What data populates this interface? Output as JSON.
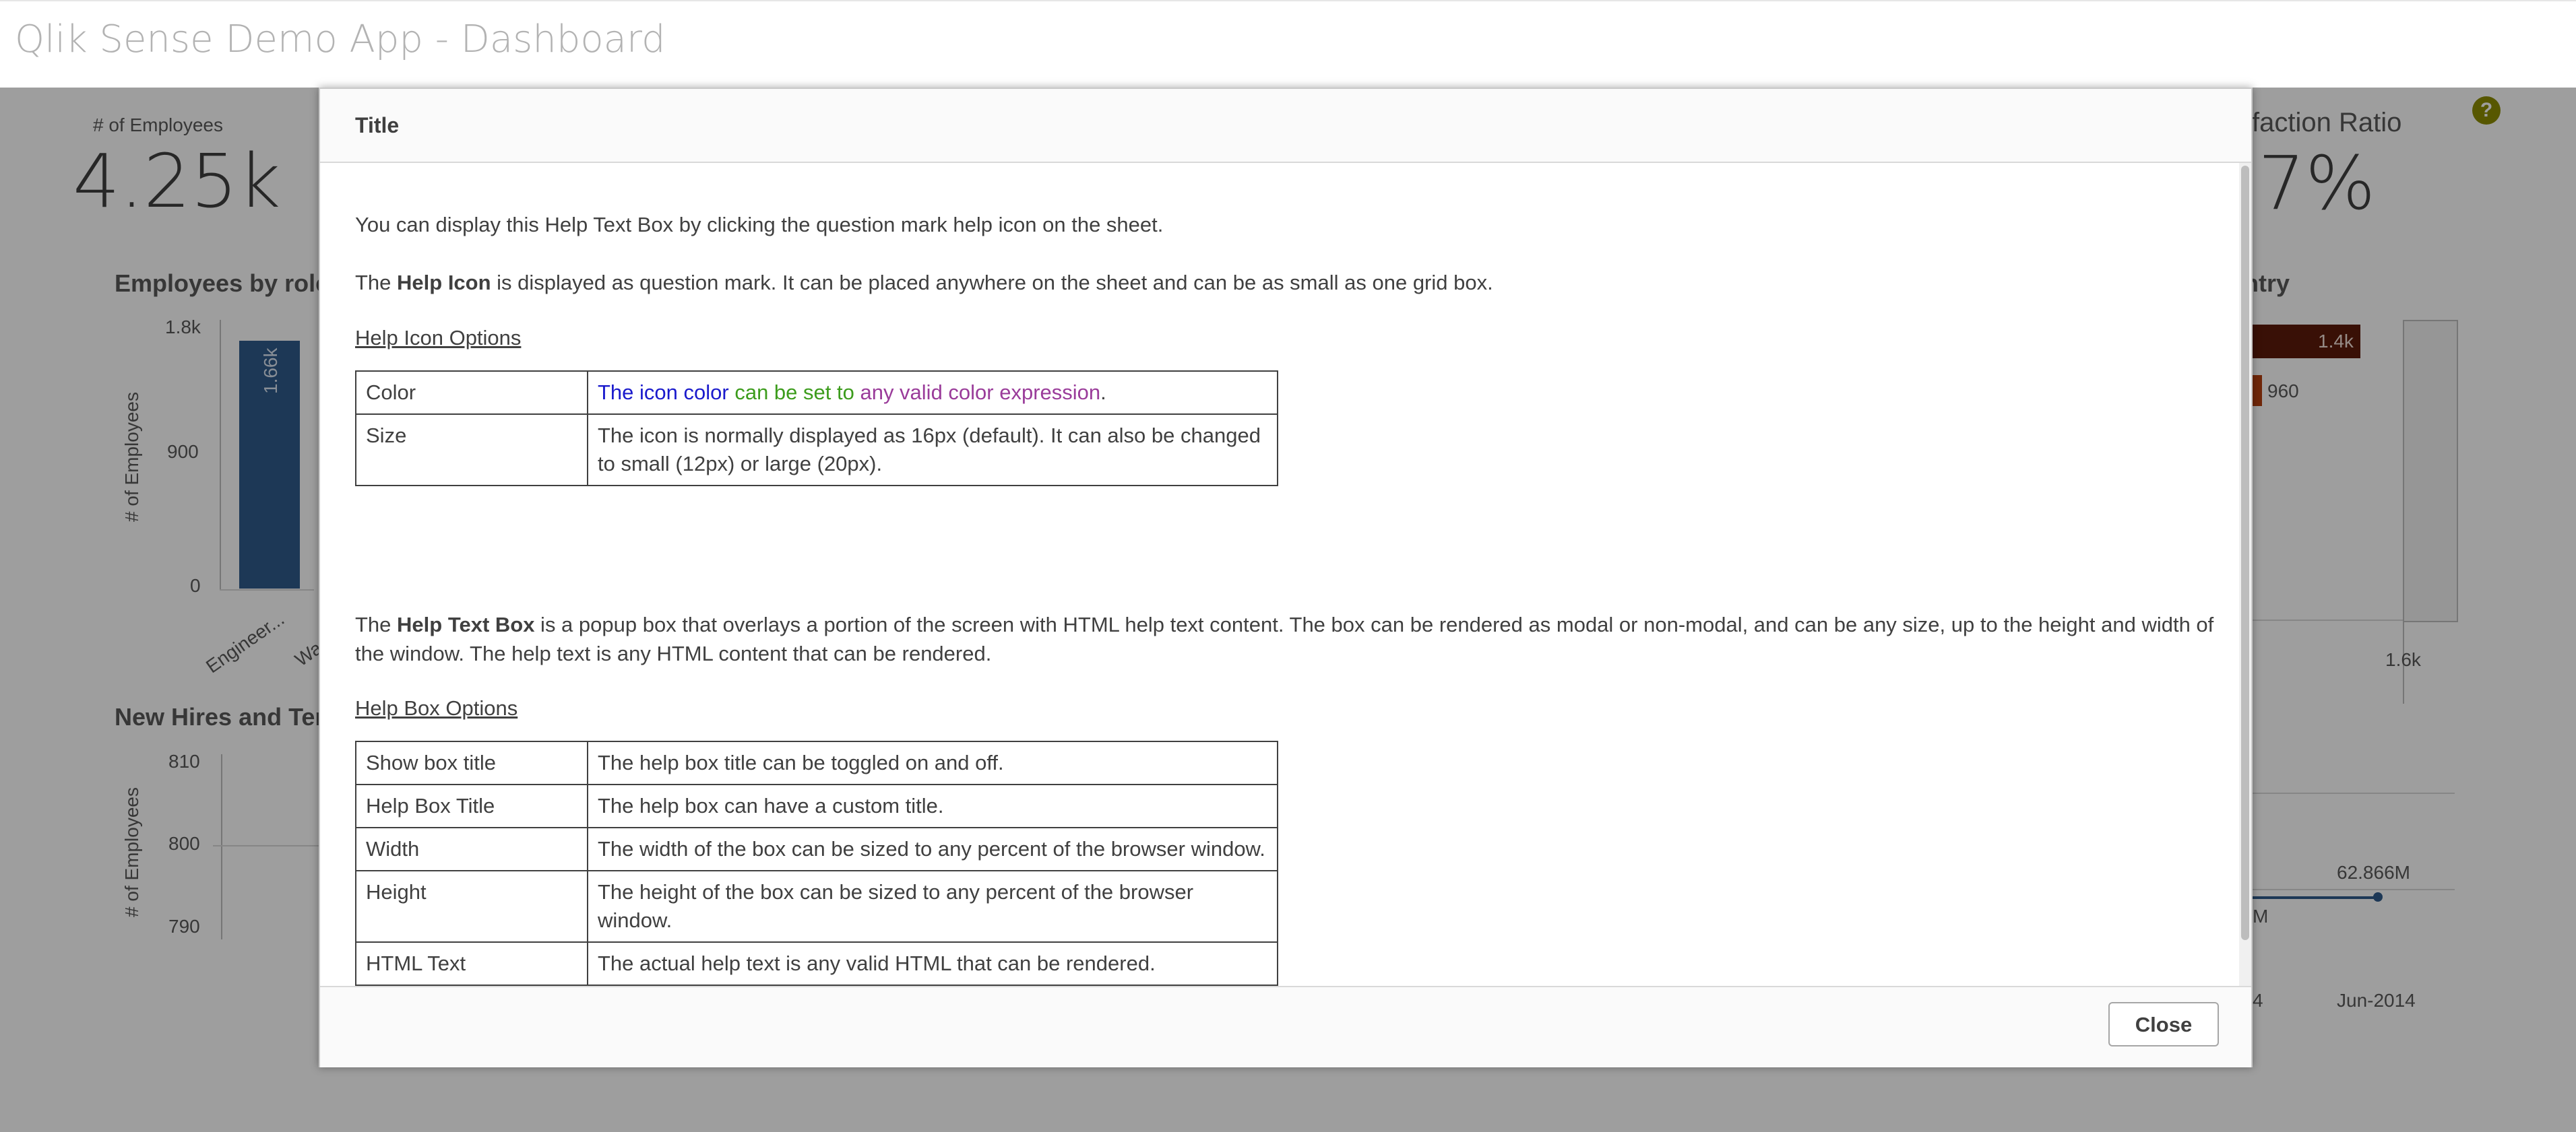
{
  "app": {
    "title": "Qlik Sense Demo App - Dashboard"
  },
  "kpis": [
    {
      "label": "# of Employees",
      "value": "4.25k"
    },
    {
      "label": "Satisfaction Ratio",
      "value_visible": ".7%",
      "label_visible": "sfaction Ratio"
    }
  ],
  "charts": {
    "employees_by_role": {
      "title": "Employees by role",
      "ylabel": "# of Employees",
      "y_ticks": [
        "1.8k",
        "900",
        "0"
      ],
      "categories_visible": [
        "Engineer...",
        "Wa"
      ],
      "bar_label": "1.66k",
      "bar_color": "#2f5b8c"
    },
    "new_hires": {
      "title": "New Hires and Ter",
      "ylabel": "# of Employees",
      "y_ticks": [
        "810",
        "800",
        "790"
      ]
    },
    "by_country": {
      "title_visible": "ntry",
      "bar_labels": [
        "1.4k",
        "960"
      ],
      "axis_tick": "1.6k"
    },
    "trend": {
      "value_label": "62.866M",
      "partial_label": "M",
      "x_ticks": [
        "4",
        "Jun-2014"
      ]
    }
  },
  "help_icon": {
    "glyph": "?",
    "color": "#8d8d00"
  },
  "modal": {
    "title": "Title",
    "para1": "You can display this Help Text Box by clicking the question mark help icon on the sheet.",
    "para2": {
      "pre": "The ",
      "bold": "Help Icon",
      "post": " is displayed as question mark. It can be placed anywhere on the sheet and can be as small as one grid box."
    },
    "section1": "Help Icon Options",
    "icon_options": [
      {
        "name": "Color",
        "parts": [
          "The icon color",
          " can be set to",
          " any valid color expression",
          "."
        ]
      },
      {
        "name": "Size",
        "desc": "The icon is normally displayed as 16px (default). It can also be changed to small (12px) or large (20px)."
      }
    ],
    "para3": {
      "pre": "The ",
      "bold": "Help Text Box",
      "post": " is a popup box that overlays a portion of the screen with HTML help text content. The box can be rendered as modal or non-modal, and can be any size, up to the height and width of the window. The help text is any HTML content that can be rendered."
    },
    "section2": "Help Box Options",
    "box_options": [
      {
        "name": "Show box title",
        "desc": "The help box title can be toggled on and off."
      },
      {
        "name": "Help Box Title",
        "desc": "The help box can have a custom title."
      },
      {
        "name": "Width",
        "desc": "The width of the box can be sized to any percent of the browser window."
      },
      {
        "name": "Height",
        "desc": "The height of the box can be sized to any percent of the browser window."
      },
      {
        "name": "HTML Text",
        "desc": "The actual help text is any valid HTML that can be rendered."
      }
    ],
    "close_label": "Close"
  }
}
